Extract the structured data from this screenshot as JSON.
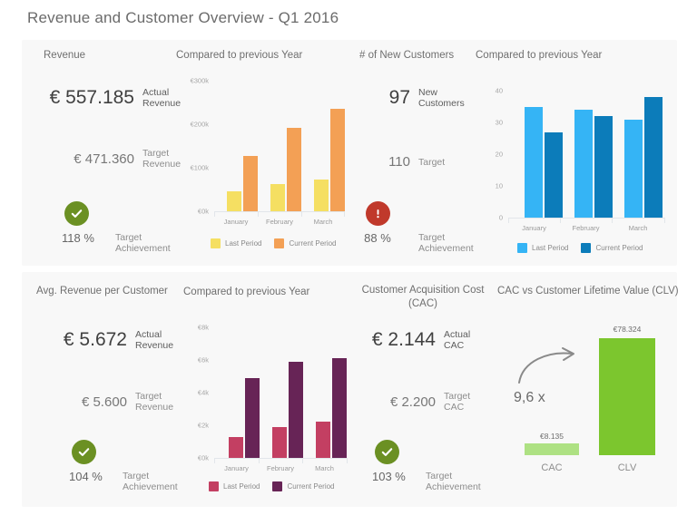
{
  "title": "Revenue and Customer Overview - Q1 2016",
  "colors": {
    "panel_bg": "#f8f8f8",
    "ok_green": "#6b9023",
    "alert_red": "#c0392b",
    "rev_last": "#f5df62",
    "rev_current": "#f3a055",
    "cust_last": "#35b4f5",
    "cust_current": "#0c7cba",
    "arpc_last": "#c33f62",
    "arpc_current": "#672456",
    "cac_bar": "#aee183",
    "clv_bar": "#7cc62e"
  },
  "panels": {
    "revenue_kpi": {
      "title": "Revenue",
      "actual_value": "€ 557.185",
      "actual_label": "Actual\nRevenue",
      "actual_label_line1": "Actual",
      "actual_label_line2": "Revenue",
      "target_value": "€ 471.360",
      "target_label_line1": "Target",
      "target_label_line2": "Revenue",
      "badge": "check",
      "achievement": "118 %",
      "achievement_label_line1": "Target",
      "achievement_label_line2": "Achievement"
    },
    "customers_kpi": {
      "title": "# of New Customers",
      "actual_value": "97",
      "actual_label_line1": "New",
      "actual_label_line2": "Customers",
      "target_value": "110",
      "target_label_line1": "Target",
      "target_label_line2": "",
      "badge": "alert",
      "achievement": "88 %",
      "achievement_label_line1": "Target",
      "achievement_label_line2": "Achievement"
    },
    "arpc_kpi": {
      "title": "Avg. Revenue per Customer",
      "actual_value": "€ 5.672",
      "actual_label_line1": "Actual",
      "actual_label_line2": "Revenue",
      "target_value": "€ 5.600",
      "target_label_line1": "Target",
      "target_label_line2": "Revenue",
      "badge": "check",
      "achievement": "104 %",
      "achievement_label_line1": "Target",
      "achievement_label_line2": "Achievement"
    },
    "cac_kpi": {
      "title_line1": "Customer Acquisition Cost",
      "title_line2": "(CAC)",
      "actual_value": "€ 2.144",
      "actual_label_line1": "Actual",
      "actual_label_line2": "CAC",
      "target_value": "€ 2.200",
      "target_label_line1": "Target",
      "target_label_line2": "CAC",
      "badge": "check",
      "achievement": "103 %",
      "achievement_label_line1": "Target",
      "achievement_label_line2": "Achievement"
    }
  },
  "chart_data": [
    {
      "id": "revenue_compare",
      "type": "bar",
      "title": "Compared to previous Year",
      "categories": [
        "January",
        "February",
        "March"
      ],
      "series": [
        {
          "name": "Last Period",
          "values": [
            45000,
            62000,
            72000
          ],
          "color": "#f5df62"
        },
        {
          "name": "Current Period",
          "values": [
            128000,
            192000,
            235000
          ],
          "color": "#f3a055"
        }
      ],
      "yticks": [
        0,
        100000,
        200000,
        300000
      ],
      "ytick_labels": [
        "€0k",
        "€100k",
        "€200k",
        "€300k"
      ],
      "ylim": [
        0,
        300000
      ],
      "xlabel": "",
      "ylabel": "",
      "grid": false,
      "legend_position": "bottom"
    },
    {
      "id": "customers_compare",
      "type": "bar",
      "title": "Compared to previous Year",
      "categories": [
        "January",
        "February",
        "March"
      ],
      "series": [
        {
          "name": "Last Period",
          "values": [
            35,
            34,
            31
          ],
          "color": "#35b4f5"
        },
        {
          "name": "Current Period",
          "values": [
            27,
            32,
            38
          ],
          "color": "#0c7cba"
        }
      ],
      "yticks": [
        0,
        10,
        20,
        30,
        40
      ],
      "ytick_labels": [
        "0",
        "10",
        "20",
        "30",
        "40"
      ],
      "ylim": [
        0,
        40
      ],
      "xlabel": "",
      "ylabel": "",
      "grid": false,
      "legend_position": "bottom"
    },
    {
      "id": "arpc_compare",
      "type": "bar",
      "title": "Compared to previous Year",
      "categories": [
        "January",
        "February",
        "March"
      ],
      "series": [
        {
          "name": "Last Period",
          "values": [
            1300,
            1900,
            2200
          ],
          "color": "#c33f62"
        },
        {
          "name": "Current Period",
          "values": [
            4900,
            5900,
            6100
          ],
          "color": "#672456"
        }
      ],
      "yticks": [
        0,
        2000,
        4000,
        6000,
        8000
      ],
      "ytick_labels": [
        "€0k",
        "€2k",
        "€4k",
        "€6k",
        "€8k"
      ],
      "ylim": [
        0,
        8000
      ],
      "xlabel": "",
      "ylabel": "",
      "grid": false,
      "legend_position": "bottom"
    },
    {
      "id": "cac_vs_clv",
      "type": "bar",
      "title": "CAC vs Customer Lifetime Value (CLV)",
      "categories": [
        "CAC",
        "CLV"
      ],
      "values": [
        8135,
        78324
      ],
      "value_labels": [
        "€8.135",
        "€78.324"
      ],
      "colors": [
        "#aee183",
        "#7cc62e"
      ],
      "ylim": [
        0,
        88000
      ],
      "annotation": "9,6 x",
      "grid": false,
      "legend_position": "none"
    }
  ]
}
